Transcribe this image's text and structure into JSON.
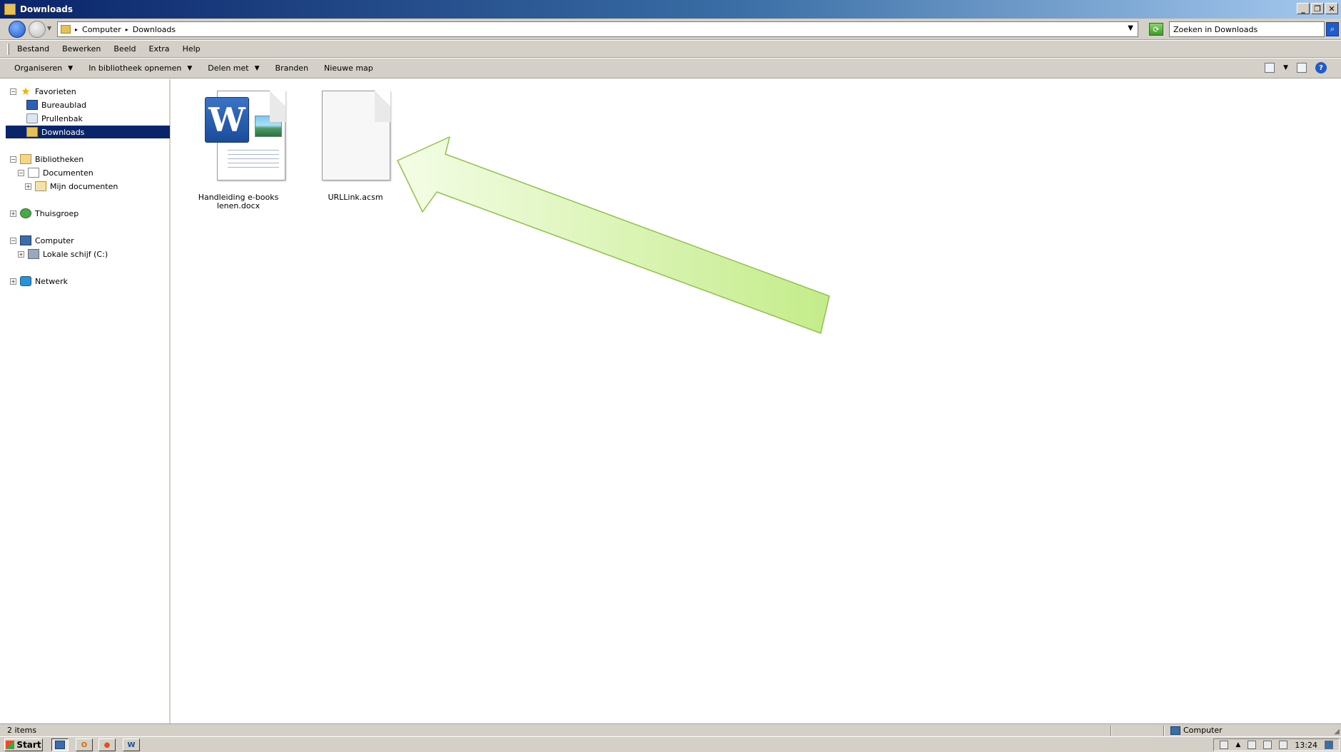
{
  "window": {
    "title": "Downloads"
  },
  "address": {
    "crumbs": [
      "Computer",
      "Downloads"
    ],
    "search_placeholder": "Zoeken in Downloads"
  },
  "menu": [
    "Bestand",
    "Bewerken",
    "Beeld",
    "Extra",
    "Help"
  ],
  "commands": {
    "organize": "Organiseren",
    "include_library": "In bibliotheek opnemen",
    "share": "Delen met",
    "burn": "Branden",
    "new_folder": "Nieuwe map"
  },
  "nav": {
    "favorites": "Favorieten",
    "desktop": "Bureaublad",
    "recycle_bin": "Prullenbak",
    "downloads": "Downloads",
    "libraries": "Bibliotheken",
    "documents": "Documenten",
    "my_documents": "Mijn documenten",
    "homegroup": "Thuisgroep",
    "computer": "Computer",
    "local_disk": "Lokale schijf (C:)",
    "network": "Netwerk"
  },
  "files": [
    {
      "name_line1": "Handleiding e-books",
      "name_line2": "lenen.docx",
      "icon": "word-document-icon"
    },
    {
      "name_line1": "URLLink.acsm",
      "icon": "blank-file-icon"
    }
  ],
  "status": {
    "count": "2 items",
    "location": "Computer"
  },
  "taskbar": {
    "start": "Start",
    "clock": "13:24"
  },
  "colors": {
    "arrow_fill_light": "#f4fde6",
    "arrow_fill_dark": "#c4ec8a",
    "selection": "#0a246a"
  }
}
